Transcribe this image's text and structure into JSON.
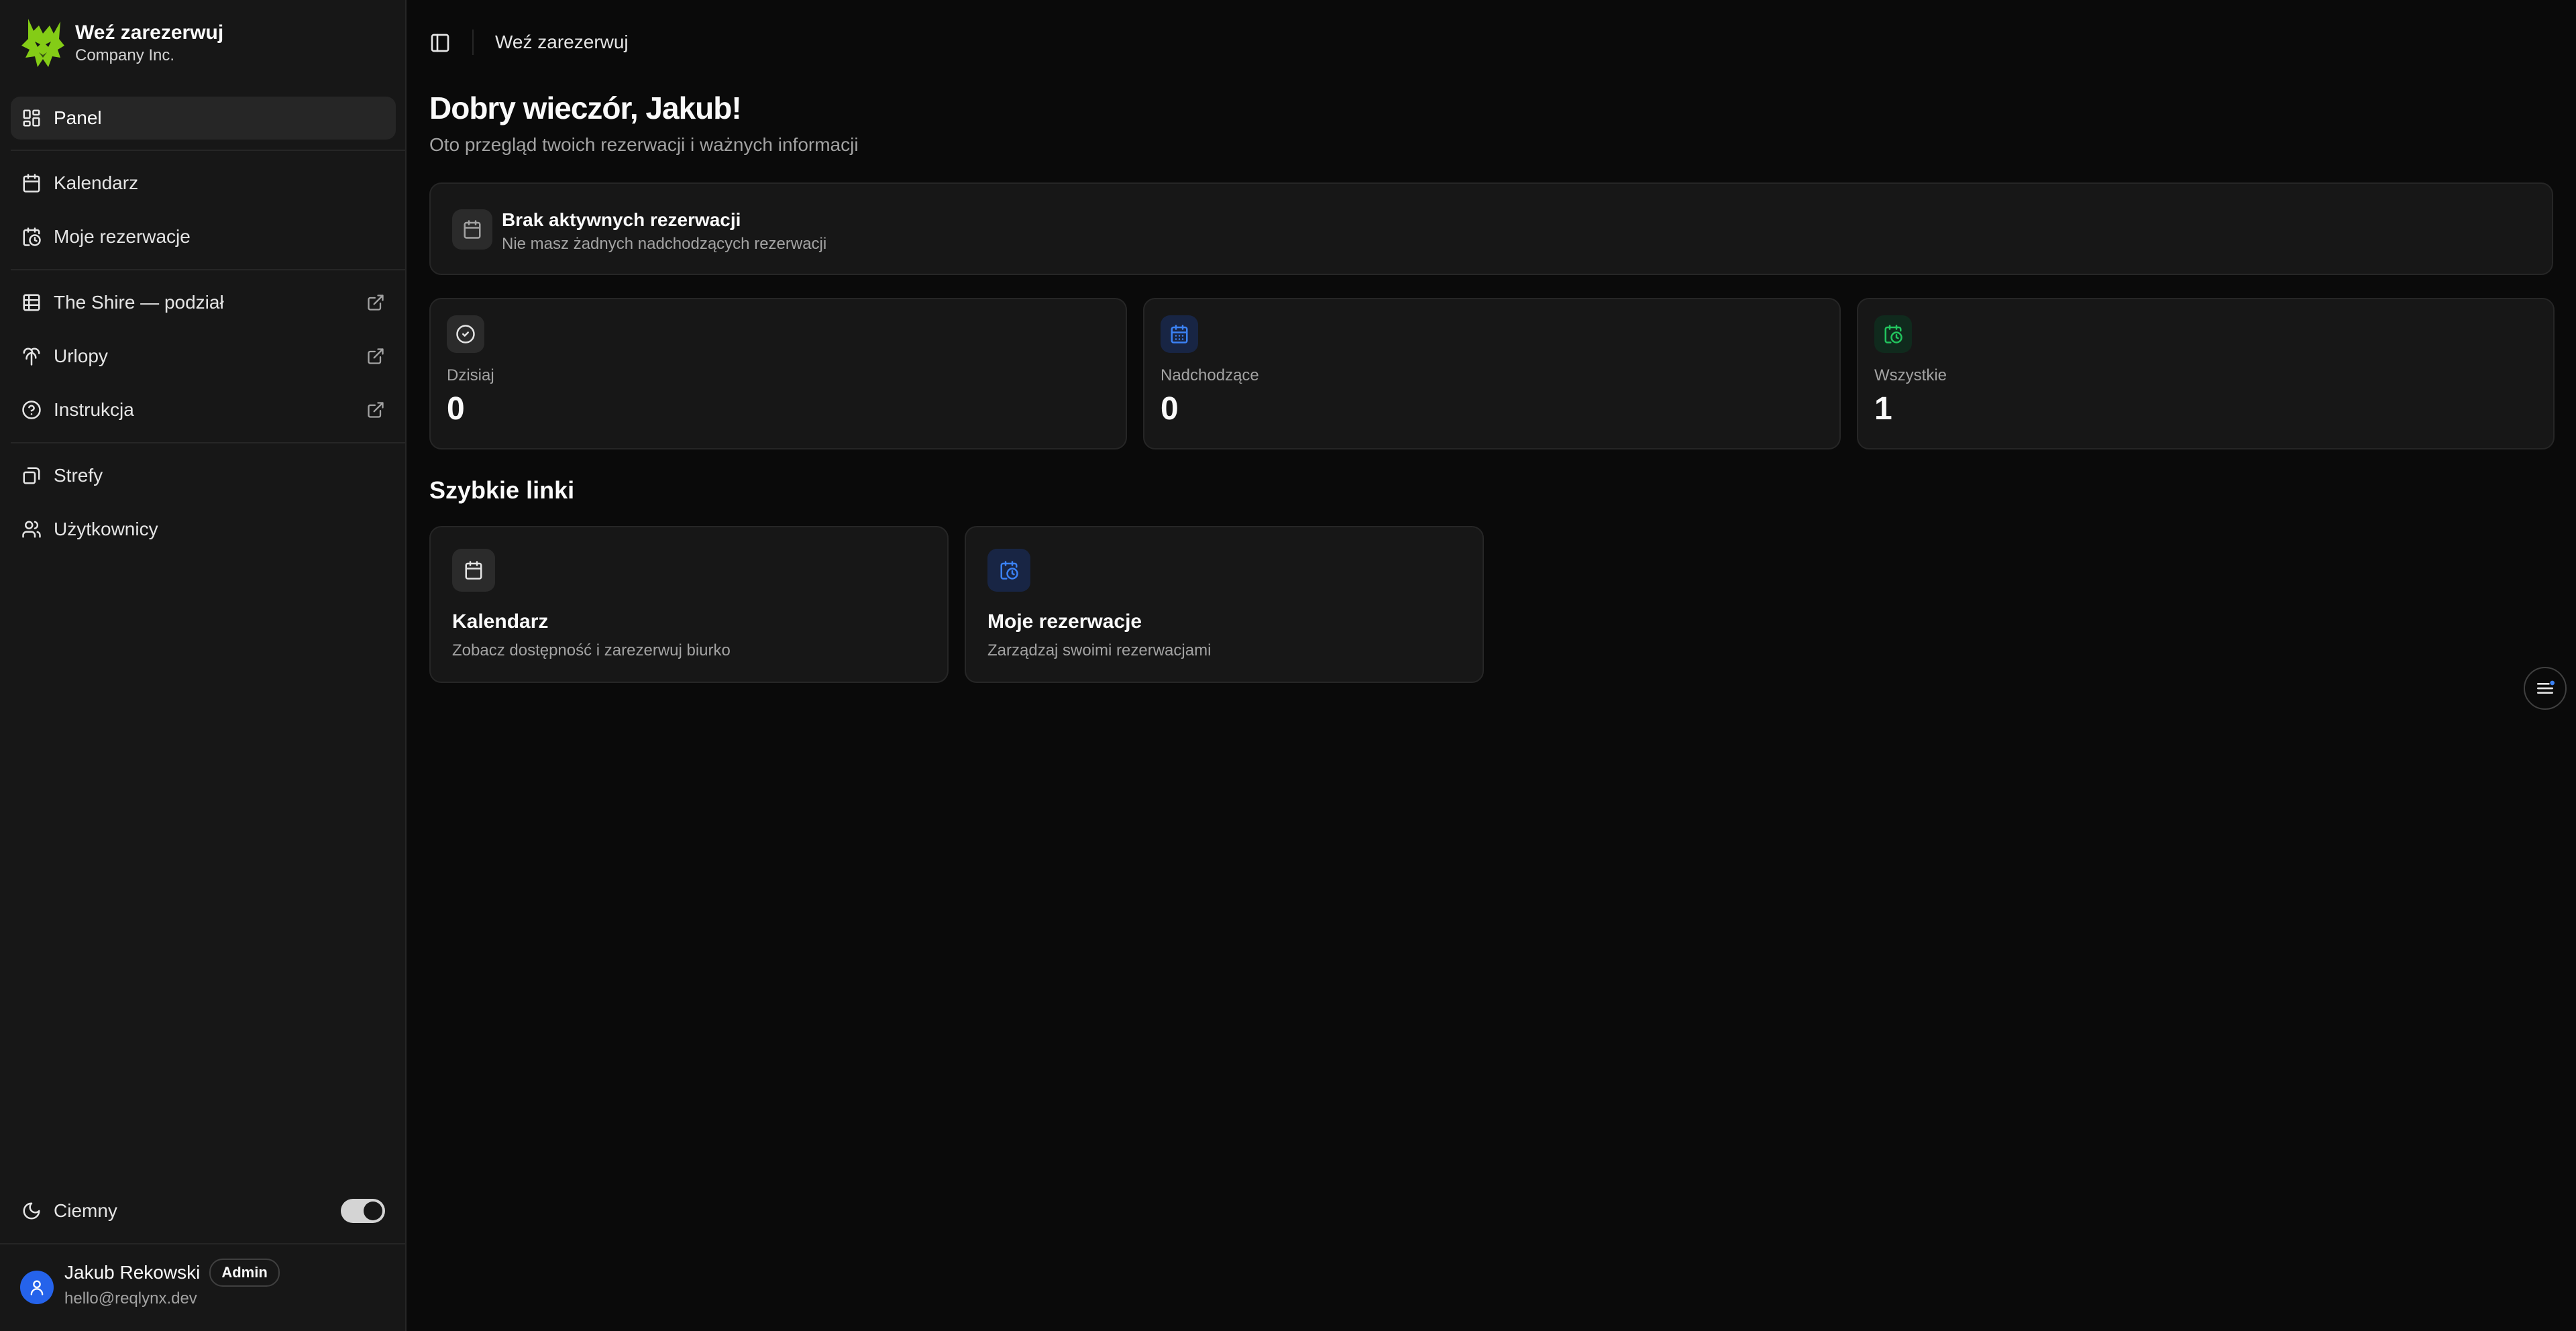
{
  "brand": {
    "name": "Weź zarezerwuj",
    "company": "Company Inc."
  },
  "sidebar": {
    "items": [
      {
        "label": "Panel",
        "icon": "dashboard-icon",
        "active": true
      },
      {
        "label": "Kalendarz",
        "icon": "calendar-icon"
      },
      {
        "label": "Moje rezerwacje",
        "icon": "calendar-clock-icon"
      },
      {
        "label": "The Shire — podział",
        "icon": "table-grid-icon",
        "external": true
      },
      {
        "label": "Urlopy",
        "icon": "palm-tree-icon",
        "external": true
      },
      {
        "label": "Instrukcja",
        "icon": "help-circle-icon",
        "external": true
      },
      {
        "label": "Strefy",
        "icon": "zones-icon"
      },
      {
        "label": "Użytkownicy",
        "icon": "users-icon"
      }
    ],
    "theme": {
      "label": "Ciemny",
      "enabled": true
    },
    "user": {
      "name": "Jakub Rekowski",
      "role": "Admin",
      "email": "hello@reqlynx.dev"
    }
  },
  "header": {
    "title": "Weź zarezerwuj"
  },
  "main": {
    "greeting": "Dobry wieczór, Jakub!",
    "subtitle": "Oto przegląd twoich rezerwacji i ważnych informacji",
    "alert": {
      "title": "Brak aktywnych rezerwacji",
      "text": "Nie masz żadnych nadchodzących rezerwacji"
    },
    "stats": [
      {
        "label": "Dzisiaj",
        "value": "0",
        "color": "#d4d4d4"
      },
      {
        "label": "Nadchodzące",
        "value": "0",
        "color": "#3b82f6"
      },
      {
        "label": "Wszystkie",
        "value": "1",
        "color": "#22c55e"
      }
    ],
    "quick_links_title": "Szybkie linki",
    "quick_links": [
      {
        "title": "Kalendarz",
        "text": "Zobacz dostępność i zarezerwuj biurko"
      },
      {
        "title": "Moje rezerwacje",
        "text": "Zarządzaj swoimi rezerwacjami"
      }
    ]
  },
  "colors": {
    "accent": "#3b82f6",
    "success": "#22c55e",
    "logo": "#84cc16"
  }
}
